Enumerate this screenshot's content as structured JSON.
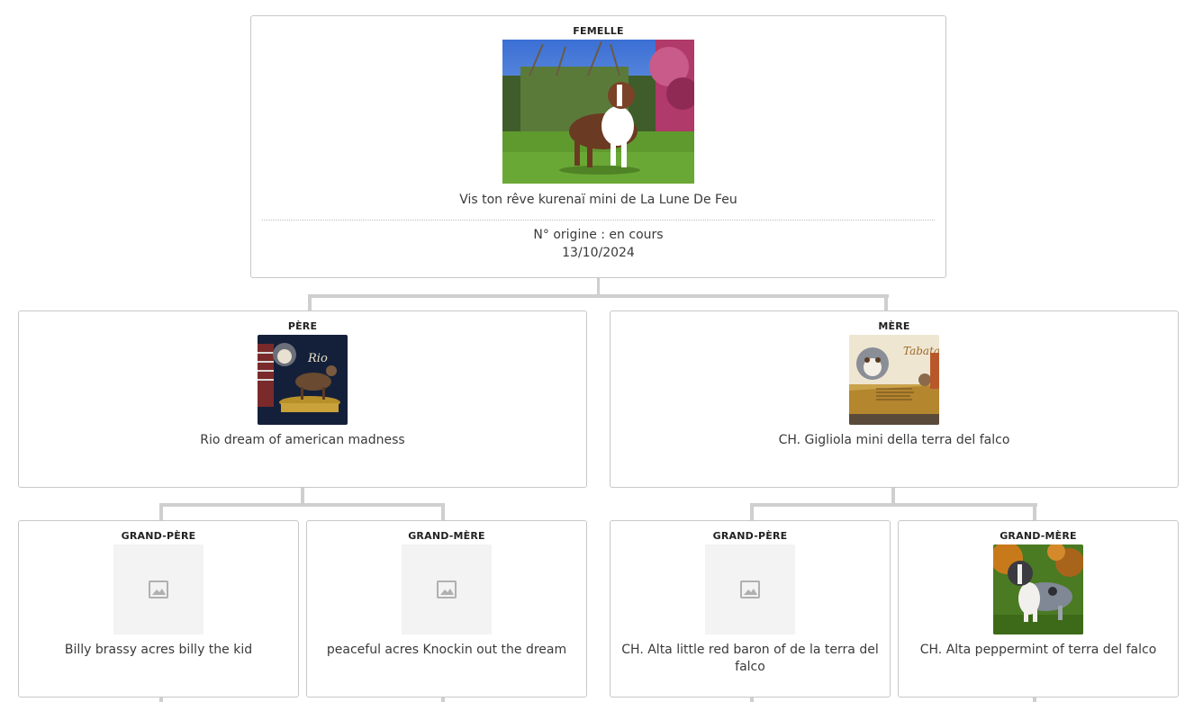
{
  "subject": {
    "role": "FEMELLE",
    "name": "Vis ton rêve kurenaï mini de La Lune De Feu",
    "origin": "N° origine : en cours",
    "birth_date": "13/10/2024",
    "photo_icon": "dog-photo"
  },
  "father": {
    "role": "PÈRE",
    "name": "Rio dream of american madness",
    "photo_icon": "dog-photo",
    "photo_caption": "Rio"
  },
  "mother": {
    "role": "MÈRE",
    "name": "CH. Gigliola mini della terra del falco",
    "photo_icon": "dog-poster-photo",
    "photo_caption": "Tabata"
  },
  "paternal_grandfather": {
    "role": "GRAND-PÈRE",
    "name": "Billy brassy acres billy the kid",
    "photo_icon": "image-placeholder-icon"
  },
  "paternal_grandmother": {
    "role": "GRAND-MÈRE",
    "name": "peaceful acres Knockin out the dream",
    "photo_icon": "image-placeholder-icon"
  },
  "maternal_grandfather": {
    "role": "GRAND-PÈRE",
    "name": "CH. Alta little red baron of de la terra del falco",
    "photo_icon": "image-placeholder-icon"
  },
  "maternal_grandmother": {
    "role": "GRAND-MÈRE",
    "name": "CH. Alta peppermint of terra del falco",
    "photo_icon": "dog-photo"
  },
  "colors": {
    "border": "#c8c8c8",
    "connector": "#cfcfcf",
    "text": "#3a3a3a"
  }
}
